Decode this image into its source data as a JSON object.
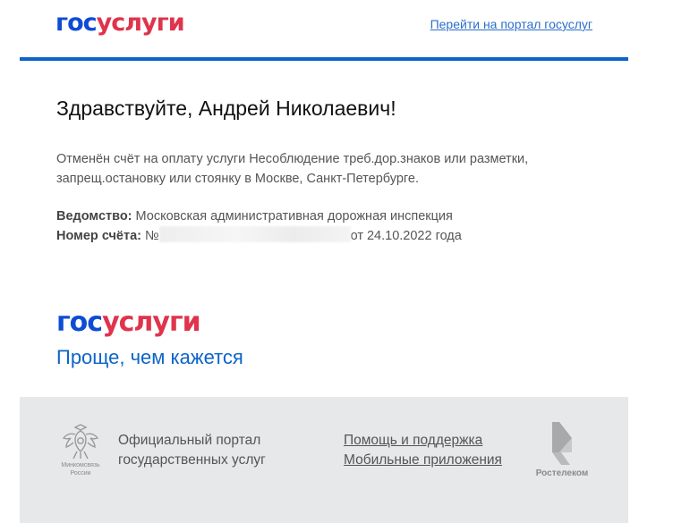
{
  "header": {
    "logo": {
      "part1": "гос",
      "part2": "услуги"
    },
    "portal_link": "Перейти на портал госуслуг"
  },
  "main": {
    "greeting": "Здравствуйте, Андрей Николаевич!",
    "message": "Отменён счёт на оплату услуги Несоблюдение треб.дор.знаков или разметки, запрещ.остановку или стоянку в Москве, Санкт-Петербурге.",
    "department_label": "Ведомство:",
    "department_value": "Московская административная дорожная инспекция",
    "invoice_label": "Номер счёта:",
    "invoice_prefix": "№",
    "invoice_suffix": "от 24.10.2022 года"
  },
  "promo": {
    "logo": {
      "part1": "гос",
      "part2": "услуги"
    },
    "slogan": "Проще, чем кажется"
  },
  "footer": {
    "emblem_icon": "coat-of-arms-icon",
    "emblem_caption_1": "Минкомсвязь",
    "emblem_caption_2": "России",
    "official_line_1": "Официальный портал",
    "official_line_2": "государственных услуг",
    "help_link": "Помощь и поддержка",
    "mobile_link": "Мобильные приложения",
    "partner_icon": "rostelecom-logo-icon",
    "partner_caption": "Ростелеком"
  },
  "colors": {
    "brand_blue": "#0d4cd3",
    "brand_red": "#e0334c",
    "link_blue": "#2c6ecb",
    "footer_bg": "#e6e8ea"
  }
}
